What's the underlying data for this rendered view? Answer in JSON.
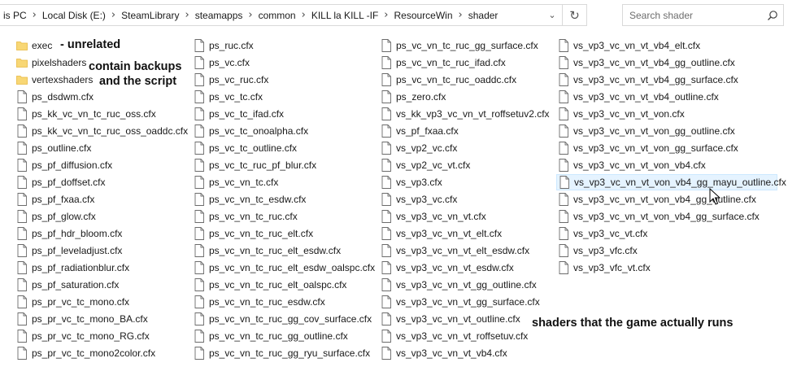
{
  "address_bar": {
    "crumbs": [
      "is PC",
      "Local Disk (E:)",
      "SteamLibrary",
      "steamapps",
      "common",
      "KILL la KILL -IF",
      "ResourceWin",
      "shader"
    ]
  },
  "search": {
    "placeholder": "Search shader",
    "value": ""
  },
  "columns": [
    [
      {
        "name": "exec",
        "type": "folder"
      },
      {
        "name": "pixelshaders",
        "type": "folder"
      },
      {
        "name": "vertexshaders",
        "type": "folder"
      },
      {
        "name": "ps_dsdwm.cfx",
        "type": "file"
      },
      {
        "name": "ps_kk_vc_vn_tc_ruc_oss.cfx",
        "type": "file"
      },
      {
        "name": "ps_kk_vc_vn_tc_ruc_oss_oaddc.cfx",
        "type": "file"
      },
      {
        "name": "ps_outline.cfx",
        "type": "file"
      },
      {
        "name": "ps_pf_diffusion.cfx",
        "type": "file"
      },
      {
        "name": "ps_pf_doffset.cfx",
        "type": "file"
      },
      {
        "name": "ps_pf_fxaa.cfx",
        "type": "file"
      },
      {
        "name": "ps_pf_glow.cfx",
        "type": "file"
      },
      {
        "name": "ps_pf_hdr_bloom.cfx",
        "type": "file"
      },
      {
        "name": "ps_pf_leveladjust.cfx",
        "type": "file"
      },
      {
        "name": "ps_pf_radiationblur.cfx",
        "type": "file"
      },
      {
        "name": "ps_pf_saturation.cfx",
        "type": "file"
      },
      {
        "name": "ps_pr_vc_tc_mono.cfx",
        "type": "file"
      },
      {
        "name": "ps_pr_vc_tc_mono_BA.cfx",
        "type": "file"
      },
      {
        "name": "ps_pr_vc_tc_mono_RG.cfx",
        "type": "file"
      },
      {
        "name": "ps_pr_vc_tc_mono2color.cfx",
        "type": "file"
      }
    ],
    [
      {
        "name": "ps_ruc.cfx",
        "type": "file"
      },
      {
        "name": "ps_vc.cfx",
        "type": "file"
      },
      {
        "name": "ps_vc_ruc.cfx",
        "type": "file"
      },
      {
        "name": "ps_vc_tc.cfx",
        "type": "file"
      },
      {
        "name": "ps_vc_tc_ifad.cfx",
        "type": "file"
      },
      {
        "name": "ps_vc_tc_onoalpha.cfx",
        "type": "file"
      },
      {
        "name": "ps_vc_tc_outline.cfx",
        "type": "file"
      },
      {
        "name": "ps_vc_tc_ruc_pf_blur.cfx",
        "type": "file"
      },
      {
        "name": "ps_vc_vn_tc.cfx",
        "type": "file"
      },
      {
        "name": "ps_vc_vn_tc_esdw.cfx",
        "type": "file"
      },
      {
        "name": "ps_vc_vn_tc_ruc.cfx",
        "type": "file"
      },
      {
        "name": "ps_vc_vn_tc_ruc_elt.cfx",
        "type": "file"
      },
      {
        "name": "ps_vc_vn_tc_ruc_elt_esdw.cfx",
        "type": "file"
      },
      {
        "name": "ps_vc_vn_tc_ruc_elt_esdw_oalspc.cfx",
        "type": "file"
      },
      {
        "name": "ps_vc_vn_tc_ruc_elt_oalspc.cfx",
        "type": "file"
      },
      {
        "name": "ps_vc_vn_tc_ruc_esdw.cfx",
        "type": "file"
      },
      {
        "name": "ps_vc_vn_tc_ruc_gg_cov_surface.cfx",
        "type": "file"
      },
      {
        "name": "ps_vc_vn_tc_ruc_gg_outline.cfx",
        "type": "file"
      },
      {
        "name": "ps_vc_vn_tc_ruc_gg_ryu_surface.cfx",
        "type": "file"
      }
    ],
    [
      {
        "name": "ps_vc_vn_tc_ruc_gg_surface.cfx",
        "type": "file"
      },
      {
        "name": "ps_vc_vn_tc_ruc_ifad.cfx",
        "type": "file"
      },
      {
        "name": "ps_vc_vn_tc_ruc_oaddc.cfx",
        "type": "file"
      },
      {
        "name": "ps_zero.cfx",
        "type": "file"
      },
      {
        "name": "vs_kk_vp3_vc_vn_vt_roffsetuv2.cfx",
        "type": "file"
      },
      {
        "name": "vs_pf_fxaa.cfx",
        "type": "file"
      },
      {
        "name": "vs_vp2_vc.cfx",
        "type": "file"
      },
      {
        "name": "vs_vp2_vc_vt.cfx",
        "type": "file"
      },
      {
        "name": "vs_vp3.cfx",
        "type": "file"
      },
      {
        "name": "vs_vp3_vc.cfx",
        "type": "file"
      },
      {
        "name": "vs_vp3_vc_vn_vt.cfx",
        "type": "file"
      },
      {
        "name": "vs_vp3_vc_vn_vt_elt.cfx",
        "type": "file"
      },
      {
        "name": "vs_vp3_vc_vn_vt_elt_esdw.cfx",
        "type": "file"
      },
      {
        "name": "vs_vp3_vc_vn_vt_esdw.cfx",
        "type": "file"
      },
      {
        "name": "vs_vp3_vc_vn_vt_gg_outline.cfx",
        "type": "file"
      },
      {
        "name": "vs_vp3_vc_vn_vt_gg_surface.cfx",
        "type": "file"
      },
      {
        "name": "vs_vp3_vc_vn_vt_outline.cfx",
        "type": "file"
      },
      {
        "name": "vs_vp3_vc_vn_vt_roffsetuv.cfx",
        "type": "file"
      },
      {
        "name": "vs_vp3_vc_vn_vt_vb4.cfx",
        "type": "file"
      }
    ],
    [
      {
        "name": "vs_vp3_vc_vn_vt_vb4_elt.cfx",
        "type": "file"
      },
      {
        "name": "vs_vp3_vc_vn_vt_vb4_gg_outline.cfx",
        "type": "file"
      },
      {
        "name": "vs_vp3_vc_vn_vt_vb4_gg_surface.cfx",
        "type": "file"
      },
      {
        "name": "vs_vp3_vc_vn_vt_vb4_outline.cfx",
        "type": "file"
      },
      {
        "name": "vs_vp3_vc_vn_vt_von.cfx",
        "type": "file"
      },
      {
        "name": "vs_vp3_vc_vn_vt_von_gg_outline.cfx",
        "type": "file"
      },
      {
        "name": "vs_vp3_vc_vn_vt_von_gg_surface.cfx",
        "type": "file"
      },
      {
        "name": "vs_vp3_vc_vn_vt_von_vb4.cfx",
        "type": "file"
      },
      {
        "name": "vs_vp3_vc_vn_vt_von_vb4_gg_mayu_outline.cfx",
        "type": "file",
        "selected": true
      },
      {
        "name": "vs_vp3_vc_vn_vt_von_vb4_gg_outline.cfx",
        "type": "file"
      },
      {
        "name": "vs_vp3_vc_vn_vt_von_vb4_gg_surface.cfx",
        "type": "file"
      },
      {
        "name": "vs_vp3_vc_vt.cfx",
        "type": "file"
      },
      {
        "name": "vs_vp3_vfc.cfx",
        "type": "file"
      },
      {
        "name": "vs_vp3_vfc_vt.cfx",
        "type": "file"
      }
    ]
  ],
  "annotations": {
    "unrelated": "- unrelated",
    "backups_line1": "contain backups",
    "backups_line2": "and the script",
    "runs": "shaders that the game actually runs"
  },
  "colors": {
    "folder": "#f8d775",
    "folder_dark": "#e8b83e",
    "selection_bg": "#e5f3ff",
    "selection_border": "#cce8ff"
  },
  "icons": {
    "separator": "chevron-right-icon",
    "address_dropdown": "chevron-down-icon",
    "refresh": "refresh-icon",
    "search": "search-icon",
    "folder": "folder-icon",
    "file": "file-icon",
    "cursor": "mouse-cursor-icon"
  }
}
